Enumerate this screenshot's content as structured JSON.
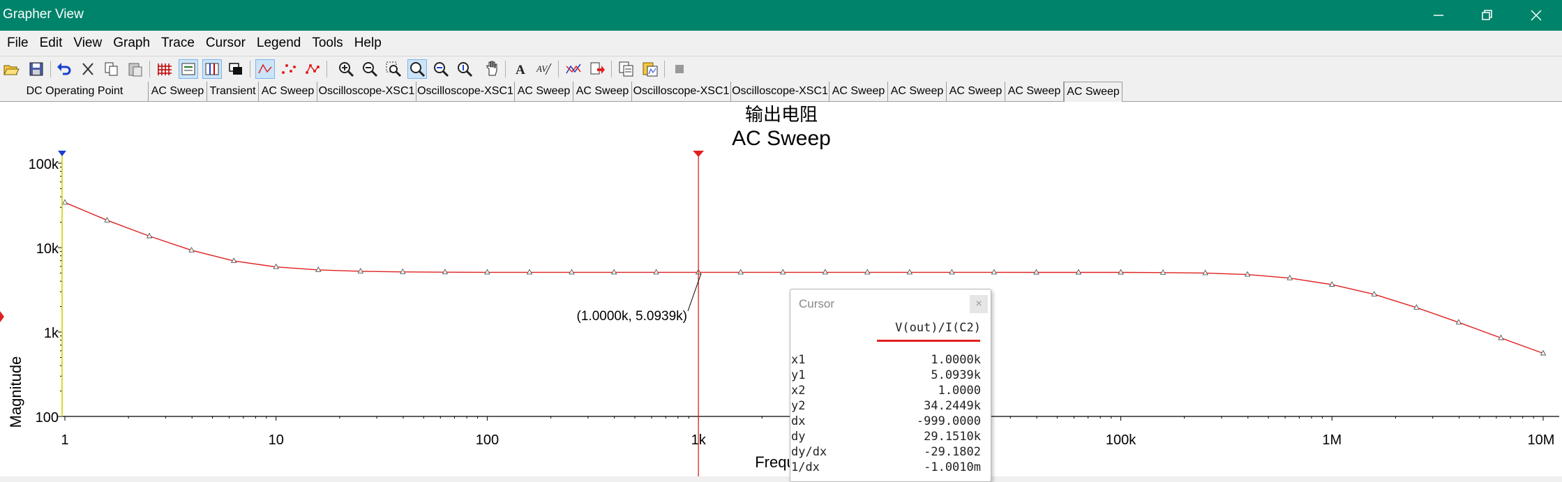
{
  "window": {
    "title": "Grapher View"
  },
  "menu": [
    "File",
    "Edit",
    "View",
    "Graph",
    "Trace",
    "Cursor",
    "Legend",
    "Tools",
    "Help"
  ],
  "tabs": [
    {
      "label": "DC Operating Point",
      "active": false
    },
    {
      "label": "AC Sweep",
      "active": false
    },
    {
      "label": "Transient",
      "active": false
    },
    {
      "label": "AC Sweep",
      "active": false
    },
    {
      "label": "Oscilloscope-XSC1",
      "active": false
    },
    {
      "label": "Oscilloscope-XSC1",
      "active": false
    },
    {
      "label": "AC Sweep",
      "active": false
    },
    {
      "label": "AC Sweep",
      "active": false
    },
    {
      "label": "Oscilloscope-XSC1",
      "active": false
    },
    {
      "label": "Oscilloscope-XSC1",
      "active": false
    },
    {
      "label": "AC Sweep",
      "active": false
    },
    {
      "label": "AC Sweep",
      "active": false
    },
    {
      "label": "AC Sweep",
      "active": false
    },
    {
      "label": "AC Sweep",
      "active": false
    },
    {
      "label": "AC Sweep",
      "active": true
    }
  ],
  "graph": {
    "title_line1": "输出电阻",
    "title_line2": "AC Sweep",
    "xlabel": "Frequency (Hz)",
    "ylabel": "Magnitude",
    "x_ticks": [
      "1",
      "10",
      "100",
      "1k",
      "10k",
      "100k",
      "1M",
      "10M"
    ],
    "y_ticks": [
      "100",
      "1k",
      "10k",
      "100k"
    ],
    "cursor_label": "(1.0000k, 5.0939k)",
    "trace_color": "#e02020",
    "cursor_color": "#e02020",
    "cursor1_color": "#e0e000"
  },
  "chart_data": {
    "type": "line",
    "xscale": "log",
    "yscale": "log",
    "xlim": [
      1,
      10000000
    ],
    "ylim": [
      100,
      100000
    ],
    "xlabel": "Frequency (Hz)",
    "ylabel": "Magnitude",
    "series": [
      {
        "name": "V(out)/I(C2)",
        "x": [
          1,
          1.585,
          2.512,
          3.981,
          6.31,
          10,
          15.85,
          25.12,
          39.81,
          63.1,
          100,
          158.5,
          251.2,
          398.1,
          631,
          1000,
          1585,
          2512,
          3981,
          6310,
          10000,
          15850,
          25120,
          39810,
          63100,
          100000,
          158500,
          251200,
          398100,
          631000,
          1000000,
          1585000,
          2512000,
          3981000,
          6310000,
          10000000
        ],
        "y": [
          34245,
          21100,
          13700,
          9300,
          6950,
          5900,
          5450,
          5250,
          5160,
          5120,
          5100,
          5095,
          5094,
          5094,
          5094,
          5094,
          5094,
          5094,
          5094,
          5094,
          5094,
          5094,
          5094,
          5093,
          5090,
          5085,
          5060,
          5000,
          4800,
          4350,
          3650,
          2800,
          1950,
          1300,
          850,
          560
        ]
      }
    ],
    "cursors": [
      {
        "name": "x1",
        "x": 1000
      },
      {
        "name": "x2",
        "x": 1
      }
    ],
    "annotation": "(1.0000k, 5.0939k)",
    "grid": false
  },
  "cursor_panel": {
    "title": "Cursor",
    "close": "×",
    "column": "V(out)/I(C2)",
    "rows": [
      {
        "k": "x1",
        "v": "1.0000k"
      },
      {
        "k": "y1",
        "v": "5.0939k"
      },
      {
        "k": "x2",
        "v": "1.0000"
      },
      {
        "k": "y2",
        "v": "34.2449k"
      },
      {
        "k": "dx",
        "v": "-999.0000"
      },
      {
        "k": "dy",
        "v": "29.1510k"
      },
      {
        "k": "dy/dx",
        "v": "-29.1802"
      },
      {
        "k": "1/dx",
        "v": "-1.0010m"
      }
    ]
  },
  "icons": [
    "open-icon",
    "save-icon",
    "undo-icon",
    "cut-icon",
    "copy-icon",
    "paste-icon",
    "grid-icon",
    "legend-icon",
    "cursors-icon",
    "overlay-icon",
    "lines-icon",
    "markers-icon",
    "lines-markers-icon",
    "zoom-in-icon",
    "zoom-out-icon",
    "zoom-area-icon",
    "zoom-full-icon",
    "zoom-x-icon",
    "zoom-y-icon",
    "pan-icon",
    "text-icon",
    "label-icon",
    "trace-icon",
    "export-icon",
    "copy-graph-icon",
    "paste-graph-icon",
    "stop-icon"
  ]
}
